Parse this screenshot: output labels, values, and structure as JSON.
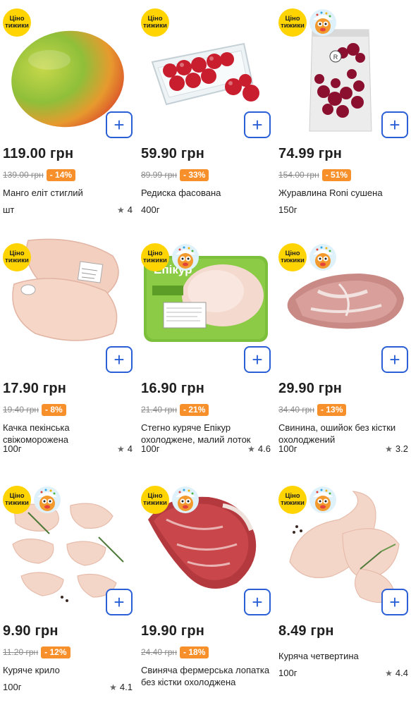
{
  "badge_text": "Ціно тижики",
  "products": [
    {
      "price": "119.00 грн",
      "old_price": "139.00 грн",
      "discount": "- 14%",
      "name": "Манго еліт стиглий",
      "unit": "шт",
      "rating": "4",
      "mascot": false
    },
    {
      "price": "59.90 грн",
      "old_price": "89.99 грн",
      "discount": "- 33%",
      "name": "Редиска фасована",
      "unit": "400г",
      "rating": "",
      "mascot": false
    },
    {
      "price": "74.99 грн",
      "old_price": "154.00 грн",
      "discount": "- 51%",
      "name": "Журавлина Roni сушена",
      "unit": "150г",
      "rating": "",
      "mascot": true
    },
    {
      "price": "17.90 грн",
      "old_price": "19.40 грн",
      "discount": "- 8%",
      "name": "Качка пекінська свіжоморожена",
      "unit": "100г",
      "rating": "4",
      "mascot": false
    },
    {
      "price": "16.90 грн",
      "old_price": "21.40 грн",
      "discount": "- 21%",
      "name": "Стегно куряче Епікур охолоджене, малий лоток",
      "unit": "100г",
      "rating": "4.6",
      "mascot": true,
      "package_brand": "Епікур"
    },
    {
      "price": "29.90 грн",
      "old_price": "34.40 грн",
      "discount": "- 13%",
      "name": "Свинина, ошийок без кістки охолоджений",
      "unit": "100г",
      "rating": "3.2",
      "mascot": true
    },
    {
      "price": "9.90 грн",
      "old_price": "11.20 грн",
      "discount": "- 12%",
      "name": "Куряче крило",
      "unit": "100г",
      "rating": "4.1",
      "mascot": true
    },
    {
      "price": "19.90 грн",
      "old_price": "24.40 грн",
      "discount": "- 18%",
      "name": "Свиняча фермерська лопатка без кістки охолоджена",
      "unit": "",
      "rating": "",
      "mascot": true
    },
    {
      "price": "8.49 грн",
      "old_price": "",
      "discount": "",
      "name": "Куряча четвертина",
      "unit": "100г",
      "rating": "4.4",
      "mascot": true
    }
  ],
  "colors": {
    "badge": "#ffd400",
    "accent": "#2a5fd6",
    "discount": "#f7902b"
  },
  "icons": {
    "add": "plus-icon",
    "star": "star-icon"
  }
}
